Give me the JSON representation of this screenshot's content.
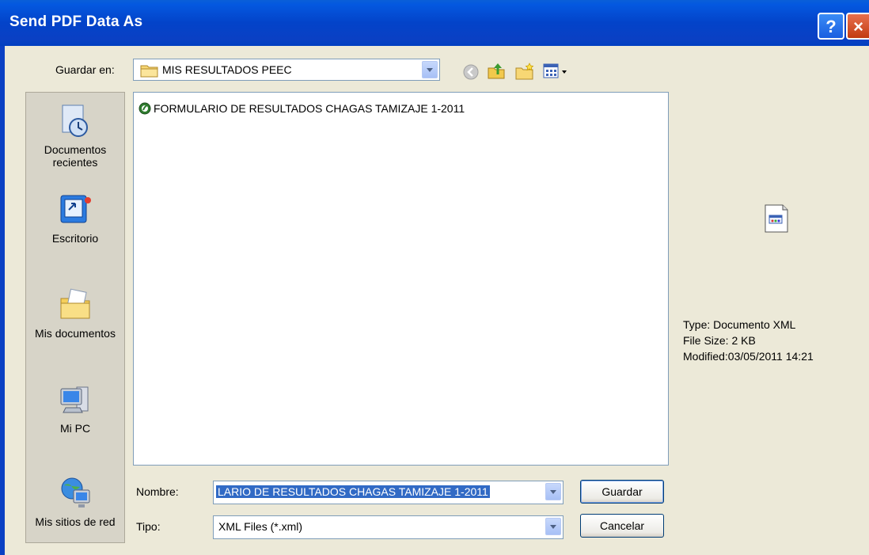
{
  "window": {
    "title": "Send PDF Data As",
    "help_glyph": "?",
    "close_glyph": "×"
  },
  "toolbar": {
    "save_in_label": "Guardar en:",
    "folder": "MIS RESULTADOS PEEC",
    "icons": [
      "back-icon",
      "up-folder-icon",
      "new-folder-icon",
      "view-menu-icon"
    ]
  },
  "places": [
    {
      "id": "recent",
      "label": "Documentos recientes",
      "icon": "recent-documents-icon"
    },
    {
      "id": "desktop",
      "label": "Escritorio",
      "icon": "desktop-icon"
    },
    {
      "id": "documents",
      "label": "Mis documentos",
      "icon": "my-documents-icon"
    },
    {
      "id": "computer",
      "label": "Mi PC",
      "icon": "my-computer-icon"
    },
    {
      "id": "network",
      "label": "Mis sitios de red",
      "icon": "network-places-icon"
    }
  ],
  "files": [
    {
      "name": "FORMULARIO DE RESULTADOS CHAGAS TAMIZAJE 1-2011",
      "icon": "xml-file-icon"
    }
  ],
  "preview": {
    "type": "Type: Documento XML",
    "size": "File Size: 2 KB",
    "modified": "Modified:03/05/2011 14:21"
  },
  "form": {
    "name_label": "Nombre:",
    "name_value": "LARIO DE RESULTADOS CHAGAS TAMIZAJE 1-2011",
    "type_label": "Tipo:",
    "type_value": "XML Files (*.xml)",
    "save_button": "Guardar",
    "cancel_button": "Cancelar"
  },
  "colors": {
    "titlebar": "#0343c9",
    "face": "#ece9d8",
    "selection": "#316ac5"
  }
}
